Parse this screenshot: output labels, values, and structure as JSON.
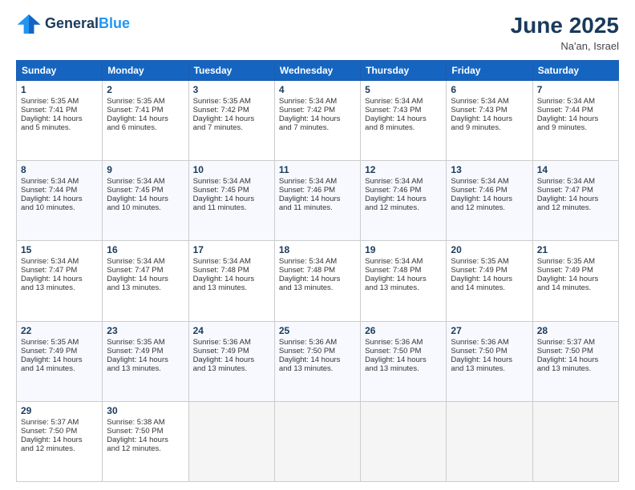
{
  "header": {
    "logo_line1": "General",
    "logo_line2": "Blue",
    "month_title": "June 2025",
    "location": "Na'an, Israel"
  },
  "days_of_week": [
    "Sunday",
    "Monday",
    "Tuesday",
    "Wednesday",
    "Thursday",
    "Friday",
    "Saturday"
  ],
  "weeks": [
    [
      {
        "day": 1,
        "lines": [
          "Sunrise: 5:35 AM",
          "Sunset: 7:41 PM",
          "Daylight: 14 hours",
          "and 5 minutes."
        ]
      },
      {
        "day": 2,
        "lines": [
          "Sunrise: 5:35 AM",
          "Sunset: 7:41 PM",
          "Daylight: 14 hours",
          "and 6 minutes."
        ]
      },
      {
        "day": 3,
        "lines": [
          "Sunrise: 5:35 AM",
          "Sunset: 7:42 PM",
          "Daylight: 14 hours",
          "and 7 minutes."
        ]
      },
      {
        "day": 4,
        "lines": [
          "Sunrise: 5:34 AM",
          "Sunset: 7:42 PM",
          "Daylight: 14 hours",
          "and 7 minutes."
        ]
      },
      {
        "day": 5,
        "lines": [
          "Sunrise: 5:34 AM",
          "Sunset: 7:43 PM",
          "Daylight: 14 hours",
          "and 8 minutes."
        ]
      },
      {
        "day": 6,
        "lines": [
          "Sunrise: 5:34 AM",
          "Sunset: 7:43 PM",
          "Daylight: 14 hours",
          "and 9 minutes."
        ]
      },
      {
        "day": 7,
        "lines": [
          "Sunrise: 5:34 AM",
          "Sunset: 7:44 PM",
          "Daylight: 14 hours",
          "and 9 minutes."
        ]
      }
    ],
    [
      {
        "day": 8,
        "lines": [
          "Sunrise: 5:34 AM",
          "Sunset: 7:44 PM",
          "Daylight: 14 hours",
          "and 10 minutes."
        ]
      },
      {
        "day": 9,
        "lines": [
          "Sunrise: 5:34 AM",
          "Sunset: 7:45 PM",
          "Daylight: 14 hours",
          "and 10 minutes."
        ]
      },
      {
        "day": 10,
        "lines": [
          "Sunrise: 5:34 AM",
          "Sunset: 7:45 PM",
          "Daylight: 14 hours",
          "and 11 minutes."
        ]
      },
      {
        "day": 11,
        "lines": [
          "Sunrise: 5:34 AM",
          "Sunset: 7:46 PM",
          "Daylight: 14 hours",
          "and 11 minutes."
        ]
      },
      {
        "day": 12,
        "lines": [
          "Sunrise: 5:34 AM",
          "Sunset: 7:46 PM",
          "Daylight: 14 hours",
          "and 12 minutes."
        ]
      },
      {
        "day": 13,
        "lines": [
          "Sunrise: 5:34 AM",
          "Sunset: 7:46 PM",
          "Daylight: 14 hours",
          "and 12 minutes."
        ]
      },
      {
        "day": 14,
        "lines": [
          "Sunrise: 5:34 AM",
          "Sunset: 7:47 PM",
          "Daylight: 14 hours",
          "and 12 minutes."
        ]
      }
    ],
    [
      {
        "day": 15,
        "lines": [
          "Sunrise: 5:34 AM",
          "Sunset: 7:47 PM",
          "Daylight: 14 hours",
          "and 13 minutes."
        ]
      },
      {
        "day": 16,
        "lines": [
          "Sunrise: 5:34 AM",
          "Sunset: 7:47 PM",
          "Daylight: 14 hours",
          "and 13 minutes."
        ]
      },
      {
        "day": 17,
        "lines": [
          "Sunrise: 5:34 AM",
          "Sunset: 7:48 PM",
          "Daylight: 14 hours",
          "and 13 minutes."
        ]
      },
      {
        "day": 18,
        "lines": [
          "Sunrise: 5:34 AM",
          "Sunset: 7:48 PM",
          "Daylight: 14 hours",
          "and 13 minutes."
        ]
      },
      {
        "day": 19,
        "lines": [
          "Sunrise: 5:34 AM",
          "Sunset: 7:48 PM",
          "Daylight: 14 hours",
          "and 13 minutes."
        ]
      },
      {
        "day": 20,
        "lines": [
          "Sunrise: 5:35 AM",
          "Sunset: 7:49 PM",
          "Daylight: 14 hours",
          "and 14 minutes."
        ]
      },
      {
        "day": 21,
        "lines": [
          "Sunrise: 5:35 AM",
          "Sunset: 7:49 PM",
          "Daylight: 14 hours",
          "and 14 minutes."
        ]
      }
    ],
    [
      {
        "day": 22,
        "lines": [
          "Sunrise: 5:35 AM",
          "Sunset: 7:49 PM",
          "Daylight: 14 hours",
          "and 14 minutes."
        ]
      },
      {
        "day": 23,
        "lines": [
          "Sunrise: 5:35 AM",
          "Sunset: 7:49 PM",
          "Daylight: 14 hours",
          "and 13 minutes."
        ]
      },
      {
        "day": 24,
        "lines": [
          "Sunrise: 5:36 AM",
          "Sunset: 7:49 PM",
          "Daylight: 14 hours",
          "and 13 minutes."
        ]
      },
      {
        "day": 25,
        "lines": [
          "Sunrise: 5:36 AM",
          "Sunset: 7:50 PM",
          "Daylight: 14 hours",
          "and 13 minutes."
        ]
      },
      {
        "day": 26,
        "lines": [
          "Sunrise: 5:36 AM",
          "Sunset: 7:50 PM",
          "Daylight: 14 hours",
          "and 13 minutes."
        ]
      },
      {
        "day": 27,
        "lines": [
          "Sunrise: 5:36 AM",
          "Sunset: 7:50 PM",
          "Daylight: 14 hours",
          "and 13 minutes."
        ]
      },
      {
        "day": 28,
        "lines": [
          "Sunrise: 5:37 AM",
          "Sunset: 7:50 PM",
          "Daylight: 14 hours",
          "and 13 minutes."
        ]
      }
    ],
    [
      {
        "day": 29,
        "lines": [
          "Sunrise: 5:37 AM",
          "Sunset: 7:50 PM",
          "Daylight: 14 hours",
          "and 12 minutes."
        ]
      },
      {
        "day": 30,
        "lines": [
          "Sunrise: 5:38 AM",
          "Sunset: 7:50 PM",
          "Daylight: 14 hours",
          "and 12 minutes."
        ]
      },
      null,
      null,
      null,
      null,
      null
    ]
  ]
}
